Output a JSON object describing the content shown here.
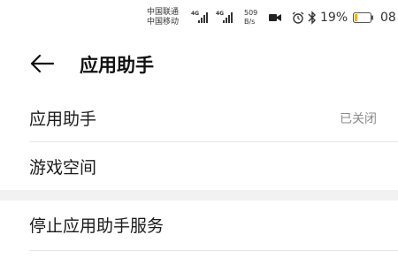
{
  "status_bar": {
    "carrier_1": "中国联通",
    "carrier_2": "中国移动",
    "signal_1_tag": "4G",
    "signal_2_tag": "4G",
    "net_speed_value": "509",
    "net_speed_unit": "B/s",
    "battery_percent": "19%",
    "battery_level": 0.19,
    "battery_color": "#f5b400",
    "clock": "08",
    "icons": [
      "camera-icon",
      "alarm-icon",
      "bluetooth-icon",
      "battery-icon"
    ]
  },
  "header": {
    "back_icon": "back-arrow-icon",
    "title": "应用助手"
  },
  "settings": {
    "assistant_label": "应用助手",
    "assistant_status": "已关闭",
    "game_space_label": "游戏空间",
    "stop_service_label": "停止应用助手服务"
  }
}
